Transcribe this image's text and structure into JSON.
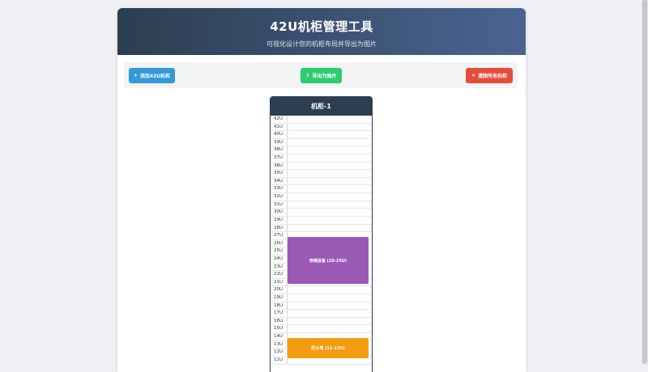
{
  "header": {
    "title": "42U机柜管理工具",
    "subtitle": "可视化设计您的机柜布局并导出为图片"
  },
  "toolbar": {
    "add": {
      "icon": "+",
      "label": "添加42U机柜"
    },
    "export": {
      "icon": "⇩",
      "label": "导出为图片"
    },
    "clear": {
      "icon": "×",
      "label": "清除所有机柜"
    }
  },
  "rack": {
    "title": "机柜-1",
    "units": [
      "42U",
      "41U",
      "40U",
      "39U",
      "38U",
      "37U",
      "36U",
      "35U",
      "34U",
      "33U",
      "32U",
      "31U",
      "30U",
      "29U",
      "28U",
      "27U",
      "26U",
      "25U",
      "24U",
      "23U",
      "22U",
      "21U",
      "20U",
      "19U",
      "18U",
      "17U",
      "16U",
      "15U",
      "14U",
      "13U",
      "12U",
      "11U"
    ],
    "devices": [
      {
        "label": "存储设备 (20-25U)",
        "color": "#9b59b6"
      },
      {
        "label": "防火墙 (11-12U)",
        "color": "#f39c12"
      }
    ]
  },
  "colors": {
    "header_start": "#2c3e50",
    "header_end": "#4a6491",
    "add_button": "#3498db",
    "export_button": "#2ecc71",
    "clear_button": "#e74c3c"
  }
}
